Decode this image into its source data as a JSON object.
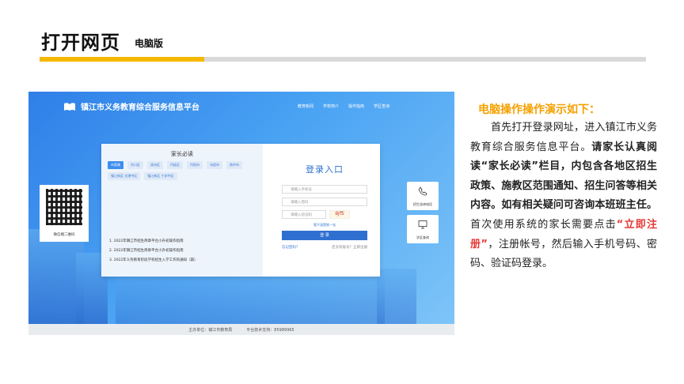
{
  "header": {
    "title": "打开网页",
    "subtitle": "电脑版"
  },
  "colors": {
    "accent": "#f5b700",
    "highlight": "#e53935",
    "brand_blue": "#2f6fd0"
  },
  "screenshot": {
    "site_title": "镇江市义务教育综合服务信息平台",
    "topnav": [
      "教育新闻",
      "学校简介",
      "操作指南",
      "学区查询"
    ],
    "notice": {
      "title": "家长必读",
      "tabs": [
        "市直属",
        "京口区",
        "润州区",
        "丹徒区",
        "丹阳市",
        "句容市",
        "扬中市",
        "镇江新区 光港中区",
        "镇江新区 丁卯中区"
      ],
      "items": [
        "1. 2022年镇江市招生简章平台小升初操作指南",
        "2. 2022年镇江市招生简章平台小升初操作指南",
        "3. 2022年义务教育阶段学校招生入学工作的通知（篇）"
      ]
    },
    "login": {
      "title": "登录入口",
      "phone_placeholder": "请输入手机号",
      "password_placeholder": "请输入密码",
      "captcha_placeholder": "请输入验证码",
      "captcha_text": "9JfS",
      "captcha_hint": "看不清楚换一张",
      "login_button": "登 录",
      "forgot": "忘记密码？",
      "register": "还没有账号？立即注册"
    },
    "qr_label": "微信端二维码",
    "side_buttons": [
      "招生咨询电话",
      "学区查询"
    ],
    "footer": [
      "主办单位：镇江市教育局",
      "平台技术支持：85989965"
    ]
  },
  "instructions": {
    "heading": "电脑操作操作演示如下：",
    "part1": "首先打开登录网址，进入镇江市义务教育综合服务信息平台。",
    "part2": "请家长认真阅读“家长必读”栏目，内包含各地区招生政策、施教区范围通知、招生问答等相关内容。如有相关疑问可咨询本班班主任。",
    "part3": "首次使用系统的家长需要点击",
    "highlight": "“立即注册”",
    "part4": "，注册帐号，然后输入手机号码、密码、验证码登录。"
  }
}
